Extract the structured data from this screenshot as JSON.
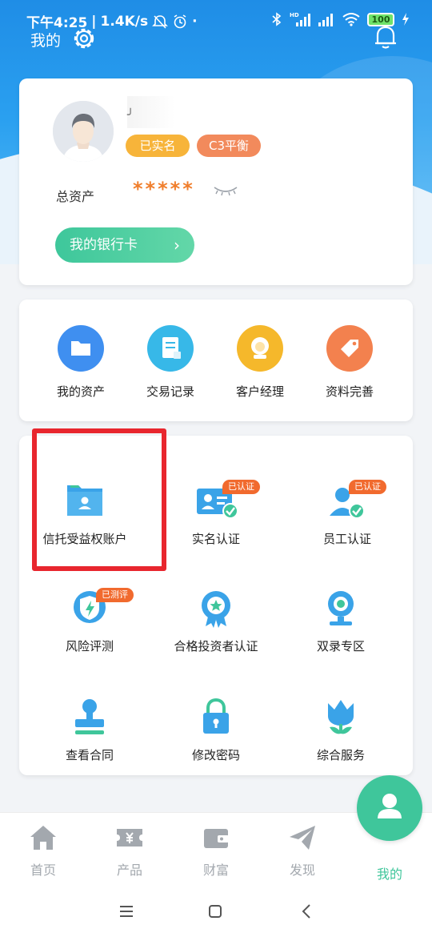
{
  "status_bar": {
    "time": "下午4:25",
    "speed": "1.4K/s",
    "hd_label": "HD",
    "battery": "100"
  },
  "header": {
    "title": "我的"
  },
  "profile": {
    "name_prefix": "╯",
    "badge_verified": "已实名",
    "badge_risk": "C3平衡",
    "total_assets_label": "总资产",
    "total_assets_value": "*****",
    "bank_card_button": "我的银行卡",
    "bank_card_chevron": "›"
  },
  "quick_actions": [
    {
      "label": "我的资产",
      "color": "#3f8ff0"
    },
    {
      "label": "交易记录",
      "color": "#37b8e8"
    },
    {
      "label": "客户经理",
      "color": "#f5b82b"
    },
    {
      "label": "资料完善",
      "color": "#f3814e"
    }
  ],
  "services": [
    {
      "label": "信托受益权账户",
      "tag": ""
    },
    {
      "label": "实名认证",
      "tag": "已认证"
    },
    {
      "label": "员工认证",
      "tag": "已认证"
    },
    {
      "label": "风险评测",
      "tag": "已测评"
    },
    {
      "label": "合格投资者认证",
      "tag": ""
    },
    {
      "label": "双录专区",
      "tag": ""
    },
    {
      "label": "查看合同",
      "tag": ""
    },
    {
      "label": "修改密码",
      "tag": ""
    },
    {
      "label": "综合服务",
      "tag": ""
    }
  ],
  "tabbar": {
    "items": [
      {
        "label": "首页"
      },
      {
        "label": "产品"
      },
      {
        "label": "财富"
      },
      {
        "label": "发现"
      },
      {
        "label": "我的",
        "active": true
      }
    ],
    "inactive_color": "#a3a8ae",
    "active_color": "#3fc69b"
  },
  "colors": {
    "brand_blue": "#2a97ec",
    "accent_green": "#3fc69b",
    "highlight_red": "#e8262e"
  }
}
